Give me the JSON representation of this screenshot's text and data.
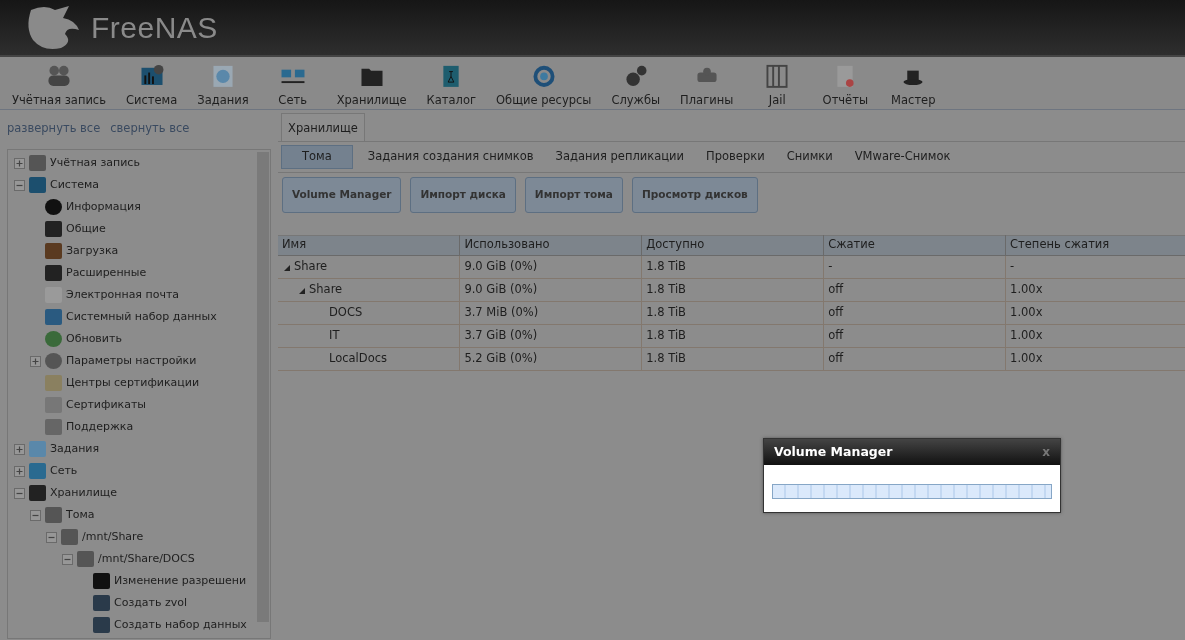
{
  "header": {
    "logo_text": "FreeNAS"
  },
  "toolbar": [
    "Учётная запись",
    "Система",
    "Задания",
    "Сеть",
    "Хранилище",
    "Каталог",
    "Общие ресурсы",
    "Службы",
    "Плагины",
    "Jail",
    "Отчёты",
    "Мастер"
  ],
  "sidebar": {
    "links": [
      "развернуть все",
      "свернуть все"
    ],
    "tree": [
      {
        "label": "Учётная запись",
        "expanded": false
      },
      {
        "label": "Система",
        "expanded": true,
        "children": [
          {
            "label": "Информация"
          },
          {
            "label": "Общие"
          },
          {
            "label": "Загрузка"
          },
          {
            "label": "Расширенные"
          },
          {
            "label": "Электронная почта"
          },
          {
            "label": "Системный набор данных"
          },
          {
            "label": "Обновить"
          },
          {
            "label": "Параметры настройки",
            "expanded": false
          },
          {
            "label": "Центры сертификации"
          },
          {
            "label": "Сертификаты"
          },
          {
            "label": "Поддержка"
          }
        ]
      },
      {
        "label": "Задания",
        "expanded": false
      },
      {
        "label": "Сеть",
        "expanded": false
      },
      {
        "label": "Хранилище",
        "expanded": true,
        "children": [
          {
            "label": "Тома",
            "expanded": true,
            "children": [
              {
                "label": "/mnt/Share",
                "expanded": true,
                "children": [
                  {
                    "label": "/mnt/Share/DOCS",
                    "expanded": true,
                    "children": [
                      {
                        "label": "Изменение разрешени"
                      },
                      {
                        "label": "Создать zvol"
                      },
                      {
                        "label": "Создать набор данных"
                      }
                    ]
                  }
                ]
              }
            ]
          }
        ]
      }
    ]
  },
  "main_tabs": [
    {
      "label": "Хранилище",
      "selected": true
    }
  ],
  "sub_tabs": [
    {
      "label": "Тома",
      "selected": true
    },
    {
      "label": "Задания создания снимков",
      "selected": false
    },
    {
      "label": "Задания репликации",
      "selected": false
    },
    {
      "label": "Проверки",
      "selected": false
    },
    {
      "label": "Снимки",
      "selected": false
    },
    {
      "label": "VMware-Снимок",
      "selected": false
    }
  ],
  "buttons": [
    "Volume Manager",
    "Импорт диска",
    "Импорт тома",
    "Просмотр дисков"
  ],
  "table": {
    "columns": [
      "Имя",
      "Использовано",
      "Доступно",
      "Сжатие",
      "Степень сжатия"
    ],
    "rows": [
      {
        "cells": [
          "Share",
          "9.0 GiB (0%)",
          "1.8 TiB",
          "-",
          "-"
        ],
        "expanded": true,
        "children": [
          {
            "cells": [
              "Share",
              "9.0 GiB (0%)",
              "1.8 TiB",
              "off",
              "1.00x"
            ],
            "expanded": true,
            "children": [
              {
                "cells": [
                  "DOCS",
                  "3.7 MiB (0%)",
                  "1.8 TiB",
                  "off",
                  "1.00x"
                ]
              },
              {
                "cells": [
                  "IT",
                  "3.7 GiB (0%)",
                  "1.8 TiB",
                  "off",
                  "1.00x"
                ]
              },
              {
                "cells": [
                  "LocalDocs",
                  "5.2 GiB (0%)",
                  "1.8 TiB",
                  "off",
                  "1.00x"
                ]
              }
            ]
          }
        ]
      }
    ]
  },
  "dialog": {
    "title": "Volume Manager",
    "close": "x",
    "progress": {
      "level": 1
    }
  }
}
